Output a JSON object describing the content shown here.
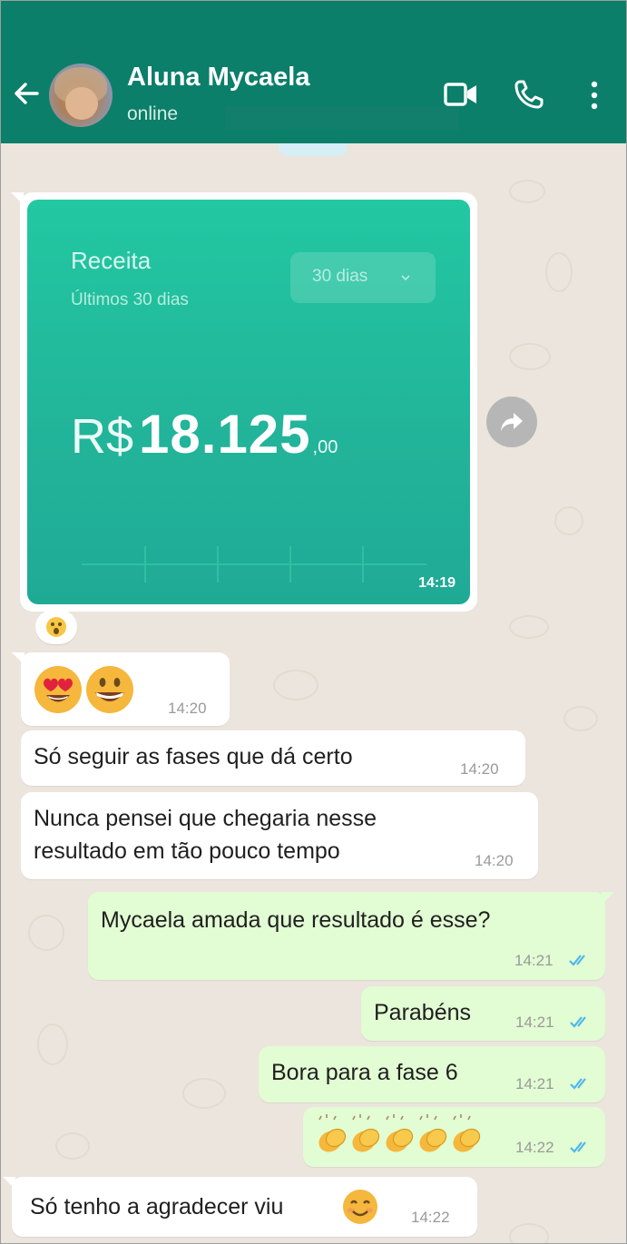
{
  "header": {
    "contact_name": "Aluna Mycaela",
    "status": "online",
    "icons": [
      "back-arrow-icon",
      "video-call-icon",
      "voice-call-icon",
      "more-options-icon"
    ]
  },
  "colors": {
    "header_bg": "#0b7f69",
    "chat_bg": "#ece5dd",
    "incoming_bubble": "#ffffff",
    "outgoing_bubble": "#e2fcd3",
    "read_ticks": "#4fb6ec",
    "card_gradient_top": "#22c8a2",
    "card_gradient_bottom": "#1faa96"
  },
  "image_message": {
    "card": {
      "title": "Receita",
      "subtitle": "Últimos 30 dias",
      "period_select": "30 dias",
      "currency": "R$",
      "value": "18.125",
      "cents": ",00"
    },
    "time": "14:19",
    "reaction": "astonished-face-emoji"
  },
  "messages": [
    {
      "direction": "in",
      "text": "",
      "emojis": [
        "heart-eyes-emoji",
        "grinning-face-emoji"
      ],
      "time": "14:20"
    },
    {
      "direction": "in",
      "text": "Só seguir as fases que dá certo",
      "time": "14:20"
    },
    {
      "direction": "in",
      "lines": [
        "Nunca pensei que chegaria nesse",
        "resultado em tão pouco tempo"
      ],
      "time": "14:20"
    },
    {
      "direction": "out",
      "text": "Mycaela amada que resultado é esse?",
      "time": "14:21",
      "status": "read"
    },
    {
      "direction": "out",
      "text": "Parabéns",
      "time": "14:21",
      "status": "read"
    },
    {
      "direction": "out",
      "text": "Bora para a fase 6",
      "time": "14:21",
      "status": "read"
    },
    {
      "direction": "out",
      "text": "",
      "emojis": [
        "clapping-hands-emoji",
        "clapping-hands-emoji",
        "clapping-hands-emoji",
        "clapping-hands-emoji",
        "clapping-hands-emoji"
      ],
      "time": "14:22",
      "status": "read"
    },
    {
      "direction": "in",
      "text": "Só tenho a agradecer viu",
      "emojis": [
        "smiling-face-emoji"
      ],
      "time": "14:22"
    }
  ]
}
